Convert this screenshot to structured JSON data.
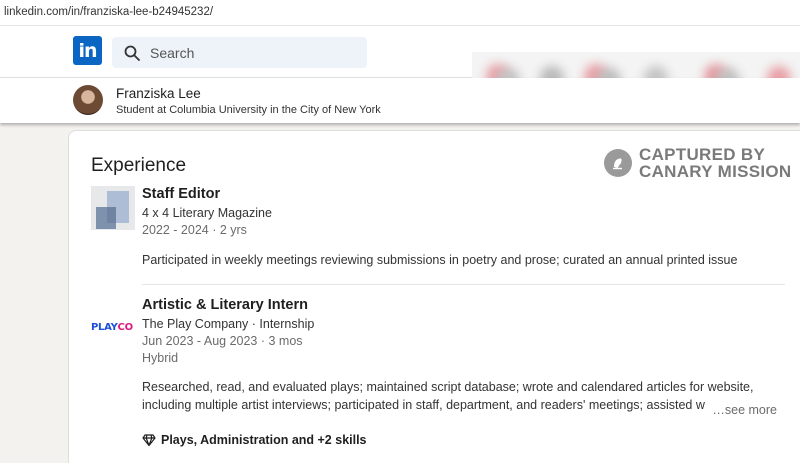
{
  "browser": {
    "url": "linkedin.com/in/franziska-lee-b24945232/"
  },
  "nav": {
    "logo_text": "in",
    "search_placeholder": "Search"
  },
  "profile": {
    "name": "Franziska Lee",
    "headline": "Student at Columbia University in the City of New York"
  },
  "section": {
    "title": "Experience"
  },
  "watermark": {
    "line1": "CAPTURED BY",
    "line2": "CANARY MISSION"
  },
  "experiences": [
    {
      "title": "Staff Editor",
      "company": "4 x 4 Literary Magazine",
      "dates": "2022 - 2024 · 2 yrs",
      "description": "Participated in weekly meetings reviewing submissions in poetry and prose; curated an annual printed issue"
    },
    {
      "title": "Artistic & Literary Intern",
      "company": "The Play Company · Internship",
      "dates": "Jun 2023 - Aug 2023 · 3 mos",
      "location": "Hybrid",
      "description_line1": "Researched, read, and evaluated plays; maintained script database; wrote and calendared articles for website,",
      "description_line2": "including multiple artist interviews; participated in staff, department, and readers' meetings; assisted w",
      "see_more": "…see more",
      "skills": "Plays, Administration and +2 skills",
      "logo_text_a": "PLAY",
      "logo_text_b": "CO"
    }
  ],
  "colors": {
    "brand": "#0a66c2",
    "playco_blue": "#1d4fd8",
    "playco_pink": "#e2197a"
  }
}
